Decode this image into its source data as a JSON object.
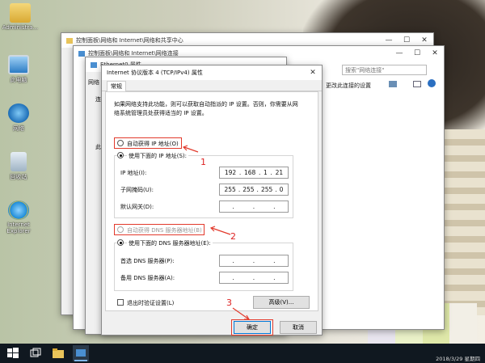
{
  "desktop": {
    "icons": [
      {
        "label": "Administra...",
        "icon": "user-folder-icon"
      },
      {
        "label": "此电脑",
        "icon": "this-pc-icon"
      },
      {
        "label": "网络",
        "icon": "network-icon"
      },
      {
        "label": "回收站",
        "icon": "recycle-bin-icon"
      },
      {
        "label": "Internet Explorer",
        "icon": "internet-explorer-icon"
      }
    ]
  },
  "window_back": {
    "path": "控制面板\\网络和 Internet\\网络和共享中心"
  },
  "window_mid": {
    "path": "控制面板\\网络和 Internet\\网络连接",
    "search_placeholder": "搜索\"网络连接\"",
    "command_text": "更改此连接的设置"
  },
  "window_ethernet": {
    "title": "Ethernet0 属性",
    "tab_fragment": "网络",
    "text_fragment_1": "连",
    "text_fragment_2": "此"
  },
  "dialog": {
    "title": "Internet 协议版本 4 (TCP/IPv4) 属性",
    "tab": "常规",
    "description": "如果网络支持此功能，则可以获取自动指派的 IP 设置。否则，你需要从网络系统管理员处获得适当的 IP 设置。",
    "auto_ip_label": "自动获得 IP 地址(O)",
    "manual_ip_label": "使用下面的 IP 地址(S):",
    "ip_label": "IP 地址(I):",
    "ip_value": [
      "192",
      "168",
      "1",
      "21"
    ],
    "subnet_label": "子网掩码(U):",
    "subnet_value": [
      "255",
      "255",
      "255",
      "0"
    ],
    "gateway_label": "默认网关(D):",
    "auto_dns_label": "自动获得 DNS 服务器地址(B)",
    "manual_dns_label": "使用下面的 DNS 服务器地址(E):",
    "preferred_dns_label": "首选 DNS 服务器(P):",
    "alternate_dns_label": "备用 DNS 服务器(A):",
    "validate_label": "退出时验证设置(L)",
    "advanced_button": "高级(V)...",
    "ok_button": "确定",
    "cancel_button": "取消"
  },
  "annotations": {
    "step1": "1",
    "step2": "2",
    "step3": "3"
  },
  "taskbar": {
    "clock_date": "2018/3/29 星期四"
  },
  "colors": {
    "accent": "#0078d7",
    "annotation_red": "#e23a2c",
    "taskbar": "#101820"
  }
}
